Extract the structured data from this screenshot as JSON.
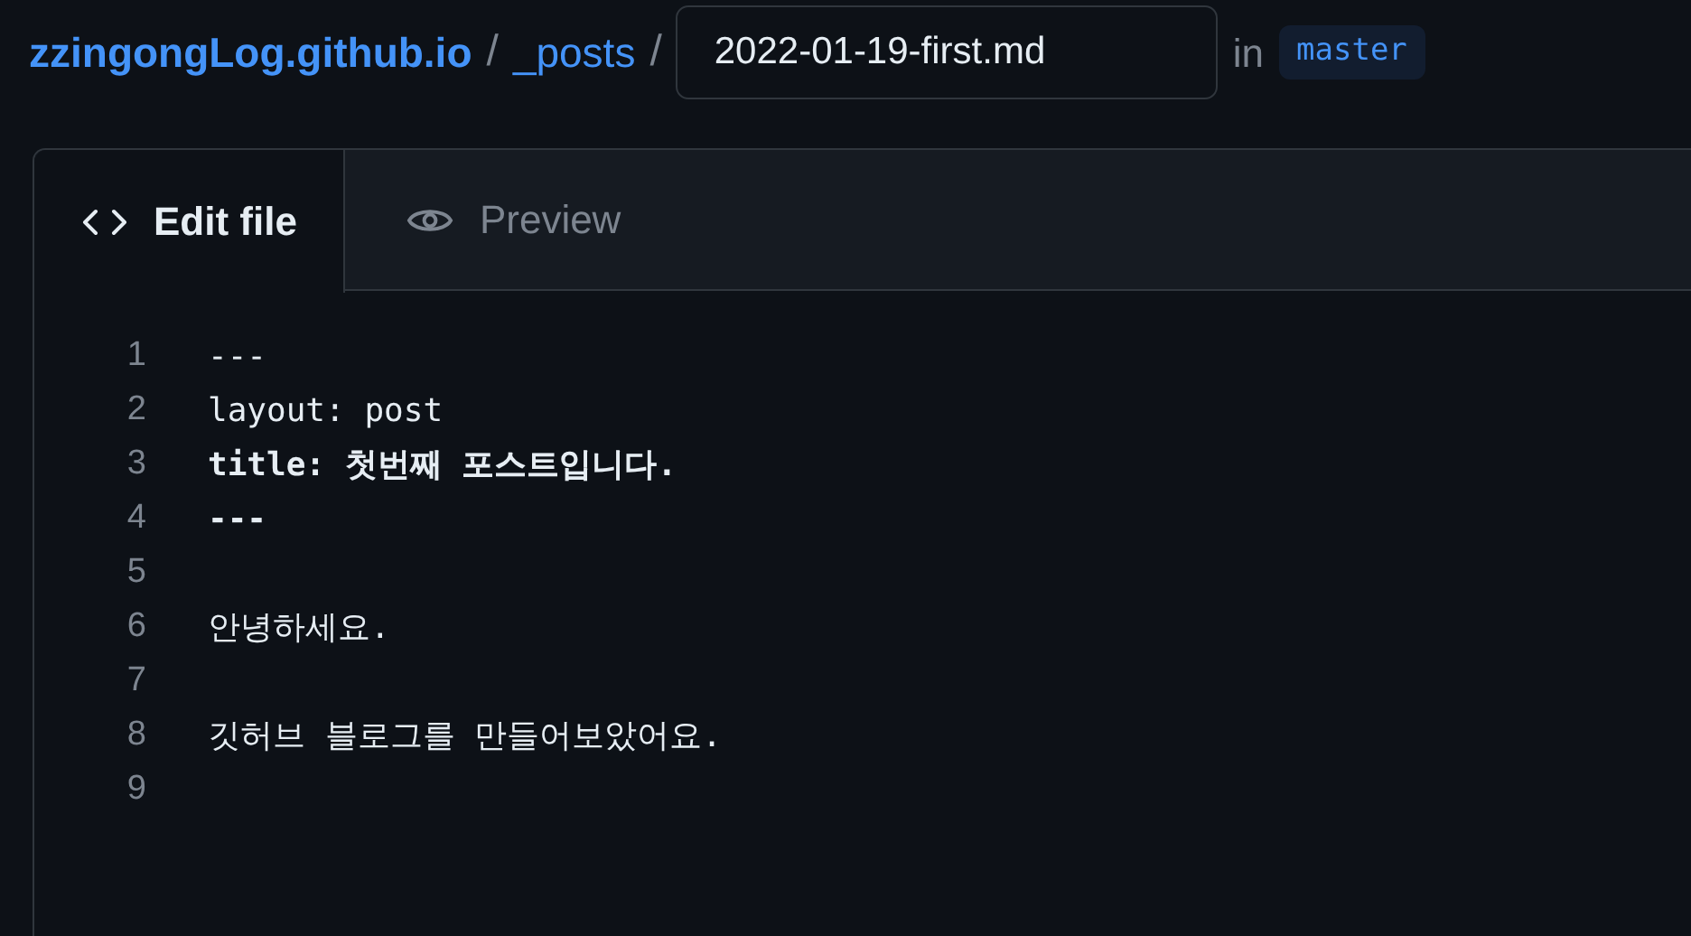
{
  "breadcrumb": {
    "repo": "zzingongLog.github.io",
    "separator_1": "/",
    "folder": "_posts",
    "separator_2": "/",
    "filename": "2022-01-19-first.md",
    "in_label": "in",
    "branch": "master"
  },
  "tabs": [
    {
      "label": "Edit file",
      "selected": true
    },
    {
      "label": "Preview",
      "selected": false
    }
  ],
  "lines": [
    {
      "number": "1",
      "text": "---",
      "bold": false
    },
    {
      "number": "2",
      "text": "layout: post",
      "bold": false
    },
    {
      "number": "3",
      "text": "title: 첫번째 포스트입니다.",
      "bold": true
    },
    {
      "number": "4",
      "text": "---",
      "bold": true
    },
    {
      "number": "5"
    },
    {
      "number": "6",
      "text": "안녕하세요.",
      "bold": false
    },
    {
      "number": "7"
    },
    {
      "number": "8",
      "text": "깃허브 블로그를 만들어보았어요.",
      "bold": false
    },
    {
      "number": "9"
    }
  ]
}
